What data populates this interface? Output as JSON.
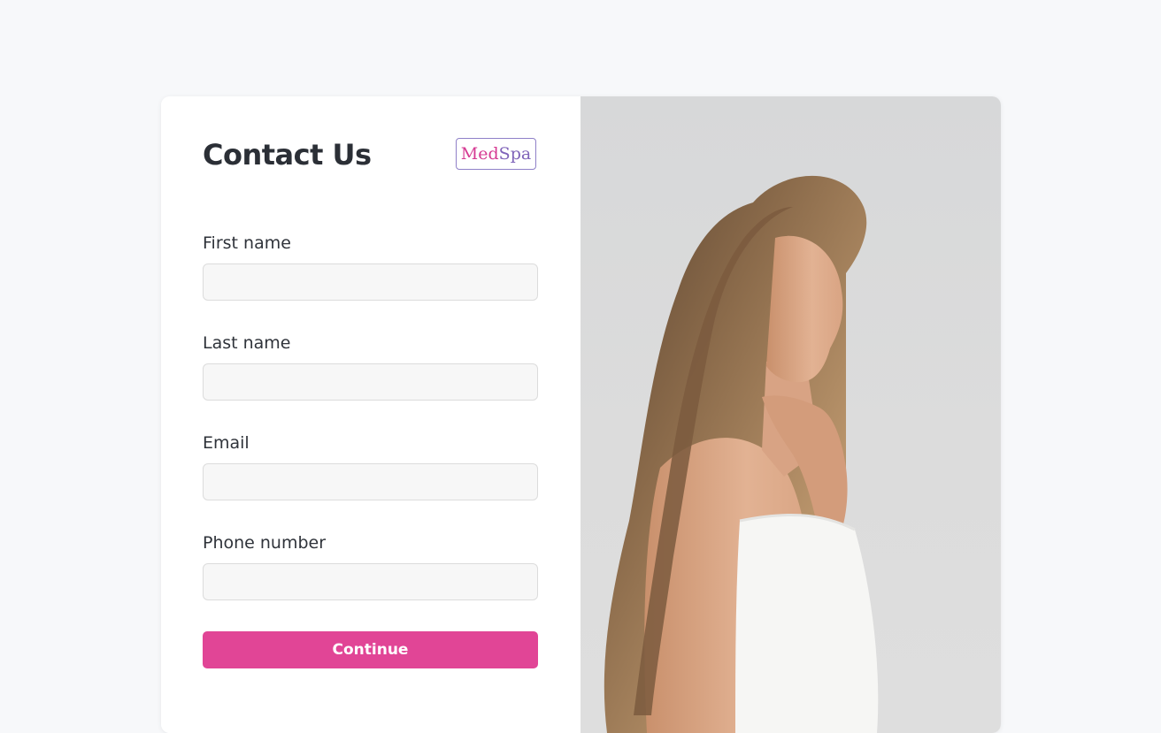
{
  "form": {
    "title": "Contact Us",
    "logo": {
      "part1": "Med",
      "part2": "Spa"
    },
    "fields": [
      {
        "label": "First name",
        "value": "",
        "placeholder": ""
      },
      {
        "label": "Last name",
        "value": "",
        "placeholder": ""
      },
      {
        "label": "Email",
        "value": "",
        "placeholder": ""
      },
      {
        "label": "Phone number",
        "value": "",
        "placeholder": ""
      }
    ],
    "submit_label": "Continue"
  },
  "colors": {
    "accent": "#e14596",
    "logo_pink": "#d63b93",
    "logo_purple": "#7f63b9",
    "title_text": "#2b2f36",
    "page_background": "#f7f8fa"
  }
}
